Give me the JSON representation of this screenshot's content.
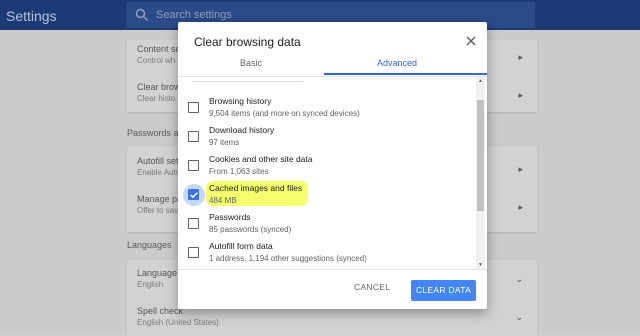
{
  "app": {
    "title": "Settings",
    "search_placeholder": "Search settings"
  },
  "background": {
    "card1": [
      {
        "title": "Content set",
        "sub": "Control wh"
      },
      {
        "title": "Clear brows",
        "sub": "Clear histo"
      }
    ],
    "section_passwords": "Passwords and",
    "card2": [
      {
        "title": "Autofill set",
        "sub": "Enable Auto"
      },
      {
        "title": "Manage pa",
        "sub": "Offer to sav"
      }
    ],
    "section_languages": "Languages",
    "card3": [
      {
        "title": "Language",
        "sub": "English"
      },
      {
        "title": "Spell check",
        "sub": "English (United States)"
      }
    ]
  },
  "dialog": {
    "title": "Clear browsing data",
    "tabs": [
      {
        "label": "Basic"
      },
      {
        "label": "Advanced"
      }
    ],
    "active_tab": "Advanced",
    "items": [
      {
        "label": "Browsing history",
        "sub": "9,504 items (and more on synced devices)",
        "checked": false
      },
      {
        "label": "Download history",
        "sub": "97 items",
        "checked": false
      },
      {
        "label": "Cookies and other site data",
        "sub": "From 1,063 sites",
        "checked": false
      },
      {
        "label": "Cached images and files",
        "sub": "484 MB",
        "checked": true,
        "highlighted": true
      },
      {
        "label": "Passwords",
        "sub": "85 passwords (synced)",
        "checked": false
      },
      {
        "label": "Autofill form data",
        "sub": "1 address, 1,194 other suggestions (synced)",
        "checked": false
      }
    ],
    "cancel_label": "CANCEL",
    "confirm_label": "CLEAR DATA"
  },
  "colors": {
    "accent": "#4285f4",
    "topbar": "#1c3a76",
    "highlight": "#f5ff6e"
  },
  "icons": {
    "search": "search-icon",
    "close": "close-icon",
    "check": "check-icon",
    "chevron": "chevron-right-icon"
  }
}
